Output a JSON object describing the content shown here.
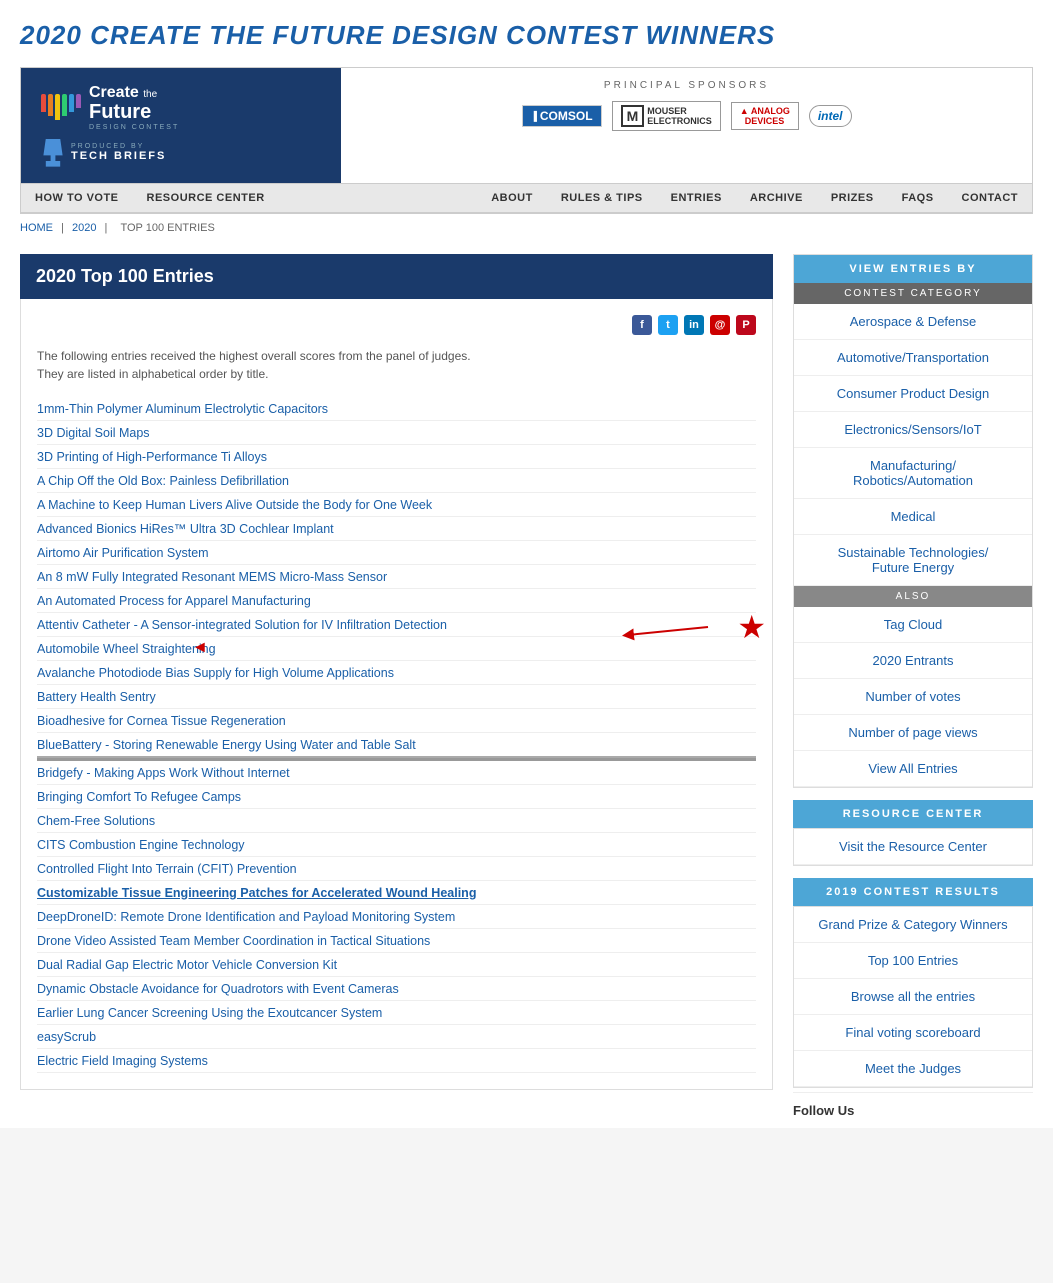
{
  "page": {
    "title": "2020 CREATE THE FUTURE DESIGN CONTEST WINNERS"
  },
  "header": {
    "logo": {
      "create": "Create",
      "the": "the",
      "future": "Future",
      "design_contest": "DESIGN CONTEST",
      "produced_by": "PRODUCED BY",
      "tech_briefs": "TECH BRIEFS"
    },
    "sponsors_label": "PRINCIPAL SPONSORS",
    "sponsors": [
      {
        "name": "COMSOL",
        "type": "comsol"
      },
      {
        "name": "MOUSER ELECTRONICS",
        "type": "mouser"
      },
      {
        "name": "ANALOG DEVICES",
        "type": "analog"
      },
      {
        "name": "intel",
        "type": "intel"
      }
    ]
  },
  "nav_left": [
    {
      "label": "HOW TO VOTE"
    },
    {
      "label": "RESOURCE CENTER"
    }
  ],
  "nav_right": [
    {
      "label": "ABOUT"
    },
    {
      "label": "RULES & TIPS"
    },
    {
      "label": "ENTRIES"
    },
    {
      "label": "ARCHIVE"
    },
    {
      "label": "PRIZES"
    },
    {
      "label": "FAQS"
    },
    {
      "label": "CONTACT"
    }
  ],
  "breadcrumb": {
    "home": "HOME",
    "year": "2020",
    "current": "TOP 100 ENTRIES"
  },
  "main": {
    "section_title": "2020 Top 100 Entries",
    "social_icons": [
      "f",
      "t",
      "in",
      "@",
      "p"
    ],
    "intro_line1": "The following entries received the highest overall scores from the panel of judges.",
    "intro_line2": "They are listed in alphabetical order by title.",
    "entries": [
      {
        "title": "1mm-Thin Polymer Aluminum Electrolytic Capacitors",
        "bold": false
      },
      {
        "title": "3D Digital Soil Maps",
        "bold": false
      },
      {
        "title": "3D Printing of High-Performance Ti Alloys",
        "bold": false
      },
      {
        "title": "A Chip Off the Old Box: Painless Defibrillation",
        "bold": false
      },
      {
        "title": "A Machine to Keep Human Livers Alive Outside the Body for One Week",
        "bold": false
      },
      {
        "title": "Advanced Bionics HiRes™ Ultra 3D Cochlear Implant",
        "bold": false
      },
      {
        "title": "Airtomo Air Purification System",
        "bold": false
      },
      {
        "title": "An 8 mW Fully Integrated Resonant MEMS Micro-Mass Sensor",
        "bold": false
      },
      {
        "title": "An Automated Process for Apparel Manufacturing",
        "bold": false
      },
      {
        "title": "Attentiv Catheter - A Sensor-integrated Solution for IV Infiltration Detection",
        "bold": false,
        "annotated": true
      },
      {
        "title": "Automobile Wheel Straightening",
        "bold": false,
        "arrow": true
      },
      {
        "title": "Avalanche Photodiode Bias Supply for High Volume Applications",
        "bold": false
      },
      {
        "title": "Battery Health Sentry",
        "bold": false
      },
      {
        "title": "Bioadhesive for Cornea Tissue Regeneration",
        "bold": false
      },
      {
        "title": "BlueBattery - Storing Renewable Energy Using Water and Table Salt",
        "bold": false
      },
      {
        "title": "Bridgefy - Making Apps Work Without Internet",
        "bold": false
      },
      {
        "title": "Bringing Comfort To Refugee Camps",
        "bold": false
      },
      {
        "title": "Chem-Free Solutions",
        "bold": false
      },
      {
        "title": "CITS Combustion Engine Technology",
        "bold": false
      },
      {
        "title": "Controlled Flight Into Terrain (CFIT) Prevention",
        "bold": false
      },
      {
        "title": "Customizable Tissue Engineering Patches for Accelerated Wound Healing",
        "bold": true
      },
      {
        "title": "DeepDroneID: Remote Drone Identification and Payload Monitoring System",
        "bold": false
      },
      {
        "title": "Drone Video Assisted Team Member Coordination in Tactical Situations",
        "bold": false
      },
      {
        "title": "Dual Radial Gap Electric Motor Vehicle Conversion Kit",
        "bold": false
      },
      {
        "title": "Dynamic Obstacle Avoidance for Quadrotors with Event Cameras",
        "bold": false
      },
      {
        "title": "Earlier Lung Cancer Screening Using the Exoutcancer System",
        "bold": false
      },
      {
        "title": "easyScrub",
        "bold": false
      },
      {
        "title": "Electric Field Imaging Systems",
        "bold": false
      }
    ]
  },
  "sidebar": {
    "view_entries_title": "VIEW ENTRIES BY",
    "contest_category_title": "CONTEST CATEGORY",
    "categories": [
      "Aerospace & Defense",
      "Automotive/Transportation",
      "Consumer Product Design",
      "Electronics/Sensors/IoT",
      "Manufacturing/\nRobotics/Automation",
      "Medical",
      "Sustainable Technologies/\nFuture Energy"
    ],
    "also_title": "ALSO",
    "also_links": [
      "Tag Cloud",
      "2020 Entrants",
      "Number of votes",
      "Number of page views",
      "View All Entries"
    ],
    "resource_center_title": "RESOURCE CENTER",
    "resource_center_link": "Visit the Resource Center",
    "contest_results_title": "2019 CONTEST RESULTS",
    "contest_results_links": [
      "Grand Prize & Category Winners",
      "Top 100 Entries",
      "Browse all the entries",
      "Final voting scoreboard",
      "Meet the Judges"
    ],
    "follow_us": "Follow Us"
  }
}
